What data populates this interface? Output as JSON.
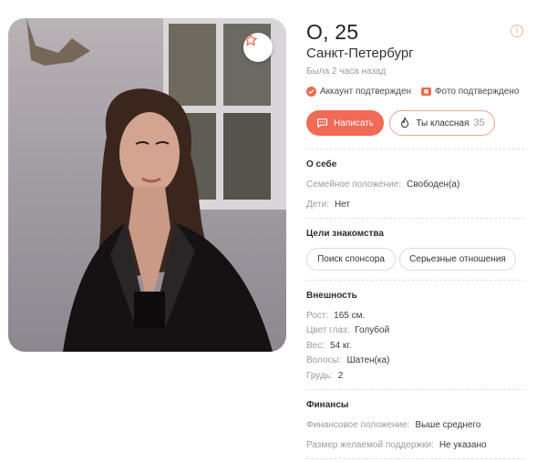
{
  "profile": {
    "name_age": "О, 25",
    "city": "Санкт-Петербург",
    "last_seen": "Была 2 часа назад",
    "verified_account": "Аккаунт подтвержден",
    "verified_photo": "Фото подтверждено"
  },
  "actions": {
    "write_label": "Написать",
    "like_label": "Ты классная",
    "like_count": "35"
  },
  "about": {
    "title": "О себе",
    "rows": [
      {
        "key": "Семейное положение:",
        "value": "Свободен(а)"
      },
      {
        "key": "Дети:",
        "value": "Нет"
      }
    ]
  },
  "goals": {
    "title": "Цели знакомства",
    "chips": [
      "Поиск спонсора",
      "Серьезные отношения"
    ]
  },
  "appearance": {
    "title": "Внешность",
    "rows": [
      {
        "key": "Рост:",
        "value": "165 см."
      },
      {
        "key": "Цвет глаз:",
        "value": "Голубой"
      },
      {
        "key": "Вес:",
        "value": "54 кг."
      },
      {
        "key": "Волосы:",
        "value": "Шатен(ка)"
      },
      {
        "key": "Грудь:",
        "value": "2"
      }
    ]
  },
  "finance": {
    "title": "Финансы",
    "rows": [
      {
        "key": "Финансовое положение:",
        "value": "Выше среднего"
      },
      {
        "key": "Размер желаемой поддержки:",
        "value": "Не указано"
      }
    ]
  },
  "colors": {
    "accent": "#f06a55",
    "accent_border": "#f2a493",
    "muted_text": "#9a9a9a"
  },
  "icons": {
    "favorite": "star-outline-icon",
    "info": "info-circle-icon",
    "write": "chat-bubble-icon",
    "like": "flame-icon",
    "account_verified": "check-badge-icon",
    "photo_verified": "camera-icon"
  }
}
